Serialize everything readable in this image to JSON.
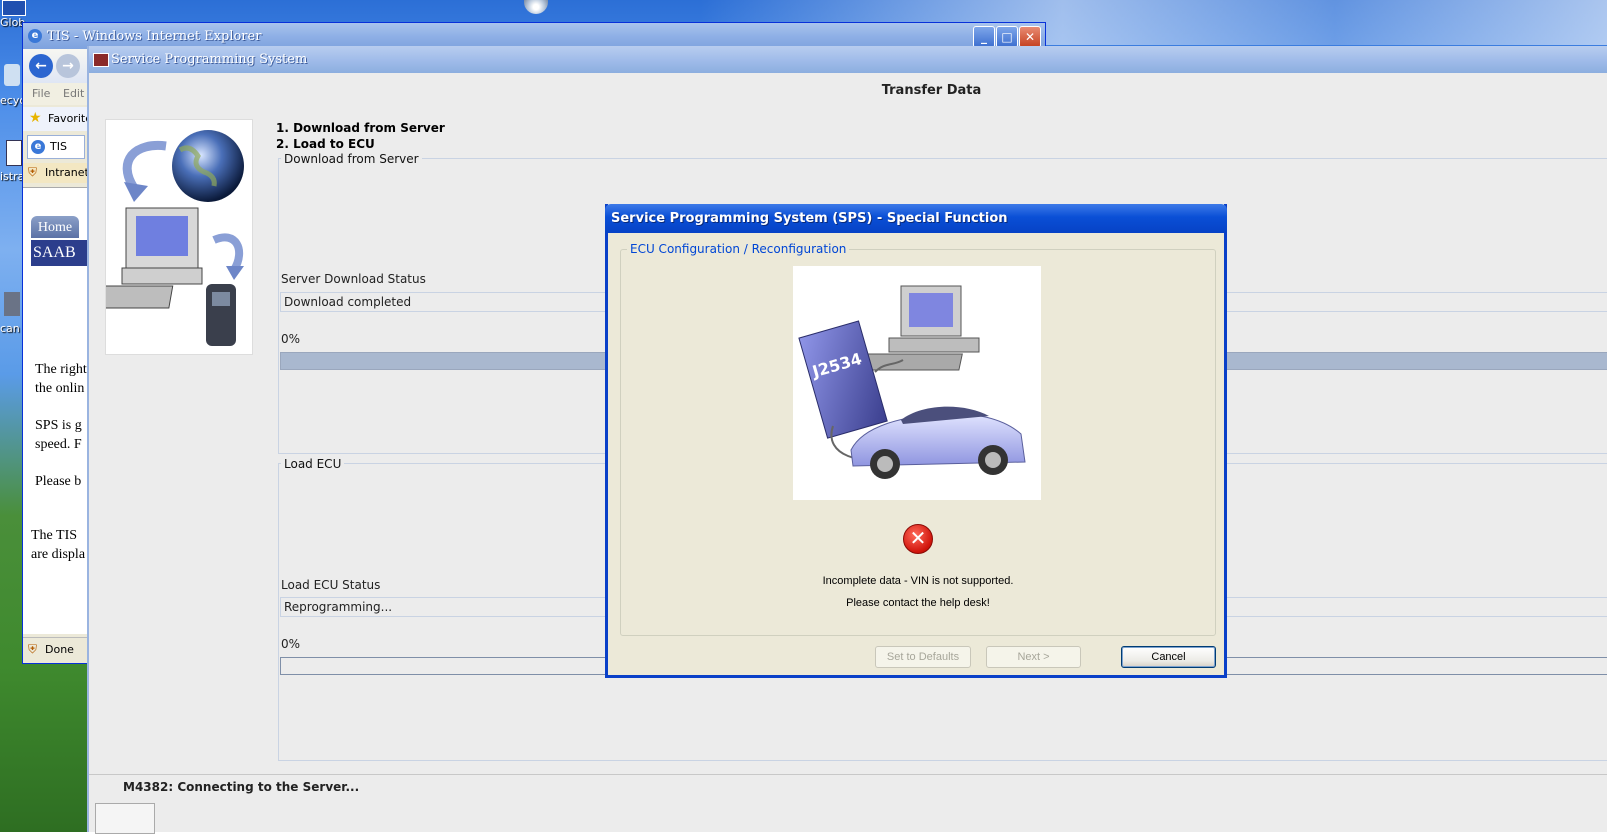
{
  "desktop": {
    "labels": [
      "Glob",
      "ecyc",
      "istra",
      "can"
    ]
  },
  "ie": {
    "title": "TIS - Windows Internet Explorer",
    "menu": [
      "File",
      "Edit"
    ],
    "favorites": "Favorite",
    "tab": "TIS",
    "zone": "Intranet",
    "home_tab": "Home",
    "brand": "SAAB",
    "text_lines": [
      "The right",
      "the onlin",
      "SPS is g",
      "speed. F",
      "Please b",
      "The TIS",
      "are displa"
    ],
    "status": "Done"
  },
  "sps": {
    "title": "Service Programming System",
    "heading": "Transfer Data",
    "steps": [
      "1. Download from Server",
      "2. Load to ECU"
    ],
    "download_group": "Download from Server",
    "server_status_label": "Server Download Status",
    "server_status_value": "Download completed",
    "download_progress": "0%",
    "load_group": "Load ECU",
    "load_status_label": "Load ECU Status",
    "load_status_value": "Reprogramming...",
    "load_progress": "0%",
    "status_message": "M4382: Connecting to the Server..."
  },
  "dialog": {
    "title": "Service Programming System (SPS) - Special Function",
    "group_label": "ECU Configuration / Reconfiguration",
    "image_label": "J2534",
    "error_line1": "Incomplete data - VIN is not supported.",
    "error_line2": "Please contact the help desk!",
    "buttons": {
      "defaults": "Set to Defaults",
      "next": "Next >",
      "cancel": "Cancel"
    }
  },
  "colors": {
    "xp_blue": "#0a40c8",
    "group_label": "#0046d5",
    "error_red": "#d0140b",
    "progress_fill": "#a9b8cf"
  }
}
